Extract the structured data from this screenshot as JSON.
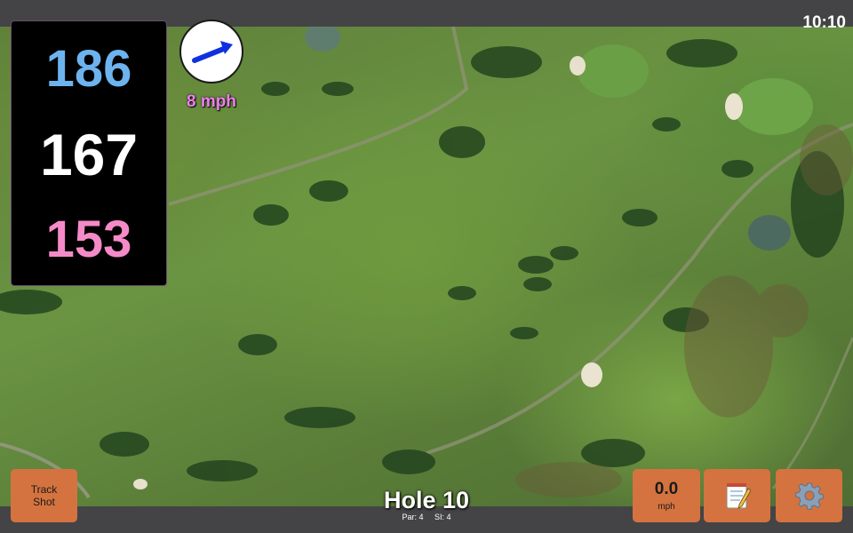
{
  "status_bar": {
    "time": "10:10"
  },
  "distances": {
    "back": "186",
    "middle": "167",
    "front": "153"
  },
  "wind": {
    "speed_label": "8 mph",
    "direction_icon": "arrow-icon"
  },
  "hole": {
    "title": "Hole 10",
    "par": "Par: 4",
    "stroke_index": "SI: 4"
  },
  "buttons": {
    "track_shot_line1": "Track",
    "track_shot_line2": "Shot",
    "wind_value": "0.0",
    "wind_unit": "mph",
    "notes_icon": "notepad-icon",
    "settings_icon": "gear-icon"
  },
  "colors": {
    "back": "#6db3ee",
    "middle": "#ffffff",
    "front": "#f58ac8",
    "wind_label": "#ef7fef",
    "button": "#d4733f"
  }
}
